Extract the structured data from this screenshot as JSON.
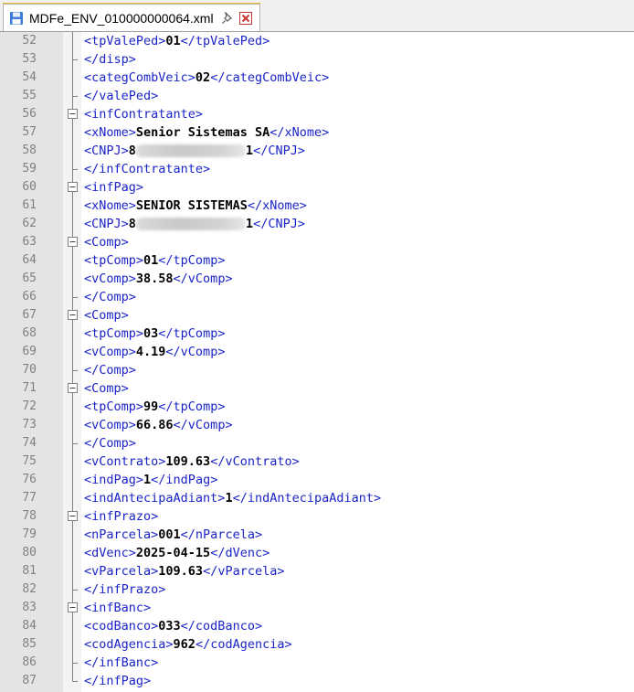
{
  "tab": {
    "title": "MDFe_ENV_010000000064.xml",
    "icons": [
      "save-icon",
      "pin-icon",
      "close-icon"
    ]
  },
  "lines": [
    {
      "n": "52",
      "parts": [
        [
          "t",
          "<tpValePed>"
        ],
        [
          "v",
          "01"
        ],
        [
          "t",
          "</tpValePed>"
        ]
      ]
    },
    {
      "n": "53",
      "parts": [
        [
          "t",
          "</disp>"
        ]
      ]
    },
    {
      "n": "54",
      "parts": [
        [
          "t",
          "<categCombVeic>"
        ],
        [
          "v",
          "02"
        ],
        [
          "t",
          "</categCombVeic>"
        ]
      ]
    },
    {
      "n": "55",
      "parts": [
        [
          "t",
          "</valePed>"
        ]
      ]
    },
    {
      "n": "56",
      "fold": "open",
      "parts": [
        [
          "t",
          "<infContratante>"
        ]
      ]
    },
    {
      "n": "57",
      "parts": [
        [
          "t",
          "<xNome>"
        ],
        [
          "v",
          "Senior Sistemas SA"
        ],
        [
          "t",
          "</xNome>"
        ]
      ]
    },
    {
      "n": "58",
      "parts": [
        [
          "t",
          "<CNPJ>"
        ],
        [
          "v",
          "8"
        ],
        [
          "b",
          ""
        ],
        [
          "v",
          "1"
        ],
        [
          "t",
          "</CNPJ>"
        ]
      ]
    },
    {
      "n": "59",
      "parts": [
        [
          "t",
          "</infContratante>"
        ]
      ]
    },
    {
      "n": "60",
      "fold": "open",
      "parts": [
        [
          "t",
          "<infPag>"
        ]
      ]
    },
    {
      "n": "61",
      "parts": [
        [
          "t",
          "<xNome>"
        ],
        [
          "v",
          "SENIOR SISTEMAS"
        ],
        [
          "t",
          "</xNome>"
        ]
      ]
    },
    {
      "n": "62",
      "parts": [
        [
          "t",
          "<CNPJ>"
        ],
        [
          "v",
          "8"
        ],
        [
          "b",
          ""
        ],
        [
          "v",
          "1"
        ],
        [
          "t",
          "</CNPJ>"
        ]
      ]
    },
    {
      "n": "63",
      "fold": "open",
      "parts": [
        [
          "t",
          "<Comp>"
        ]
      ]
    },
    {
      "n": "64",
      "parts": [
        [
          "t",
          "<tpComp>"
        ],
        [
          "v",
          "01"
        ],
        [
          "t",
          "</tpComp>"
        ]
      ]
    },
    {
      "n": "65",
      "parts": [
        [
          "t",
          "<vComp>"
        ],
        [
          "v",
          "38.58"
        ],
        [
          "t",
          "</vComp>"
        ]
      ]
    },
    {
      "n": "66",
      "parts": [
        [
          "t",
          "</Comp>"
        ]
      ]
    },
    {
      "n": "67",
      "fold": "open",
      "parts": [
        [
          "t",
          "<Comp>"
        ]
      ]
    },
    {
      "n": "68",
      "parts": [
        [
          "t",
          "<tpComp>"
        ],
        [
          "v",
          "03"
        ],
        [
          "t",
          "</tpComp>"
        ]
      ]
    },
    {
      "n": "69",
      "parts": [
        [
          "t",
          "<vComp>"
        ],
        [
          "v",
          "4.19"
        ],
        [
          "t",
          "</vComp>"
        ]
      ]
    },
    {
      "n": "70",
      "parts": [
        [
          "t",
          "</Comp>"
        ]
      ]
    },
    {
      "n": "71",
      "fold": "open",
      "parts": [
        [
          "t",
          "<Comp>"
        ]
      ]
    },
    {
      "n": "72",
      "parts": [
        [
          "t",
          "<tpComp>"
        ],
        [
          "v",
          "99"
        ],
        [
          "t",
          "</tpComp>"
        ]
      ]
    },
    {
      "n": "73",
      "parts": [
        [
          "t",
          "<vComp>"
        ],
        [
          "v",
          "66.86"
        ],
        [
          "t",
          "</vComp>"
        ]
      ]
    },
    {
      "n": "74",
      "parts": [
        [
          "t",
          "</Comp>"
        ]
      ]
    },
    {
      "n": "75",
      "parts": [
        [
          "t",
          "<vContrato>"
        ],
        [
          "v",
          "109.63"
        ],
        [
          "t",
          "</vContrato>"
        ]
      ]
    },
    {
      "n": "76",
      "parts": [
        [
          "t",
          "<indPag>"
        ],
        [
          "v",
          "1"
        ],
        [
          "t",
          "</indPag>"
        ]
      ]
    },
    {
      "n": "77",
      "parts": [
        [
          "t",
          "<indAntecipaAdiant>"
        ],
        [
          "v",
          "1"
        ],
        [
          "t",
          "</indAntecipaAdiant>"
        ]
      ]
    },
    {
      "n": "78",
      "fold": "open",
      "parts": [
        [
          "t",
          "<infPrazo>"
        ]
      ]
    },
    {
      "n": "79",
      "parts": [
        [
          "t",
          "<nParcela>"
        ],
        [
          "v",
          "001"
        ],
        [
          "t",
          "</nParcela>"
        ]
      ]
    },
    {
      "n": "80",
      "parts": [
        [
          "t",
          "<dVenc>"
        ],
        [
          "v",
          "2025-04-15"
        ],
        [
          "t",
          "</dVenc>"
        ]
      ]
    },
    {
      "n": "81",
      "parts": [
        [
          "t",
          "<vParcela>"
        ],
        [
          "v",
          "109.63"
        ],
        [
          "t",
          "</vParcela>"
        ]
      ]
    },
    {
      "n": "82",
      "parts": [
        [
          "t",
          "</infPrazo>"
        ]
      ]
    },
    {
      "n": "83",
      "fold": "open",
      "parts": [
        [
          "t",
          "<infBanc>"
        ]
      ]
    },
    {
      "n": "84",
      "parts": [
        [
          "t",
          "<codBanco>"
        ],
        [
          "v",
          "033"
        ],
        [
          "t",
          "</codBanco>"
        ]
      ]
    },
    {
      "n": "85",
      "parts": [
        [
          "t",
          "<codAgencia>"
        ],
        [
          "v",
          "962"
        ],
        [
          "t",
          "</codAgencia>"
        ]
      ]
    },
    {
      "n": "86",
      "parts": [
        [
          "t",
          "</infBanc>"
        ]
      ]
    },
    {
      "n": "87",
      "parts": [
        [
          "t",
          "</infPag>"
        ]
      ]
    }
  ],
  "colors": {
    "tag": "#1a24c8",
    "value": "#000000",
    "line_number": "#808080",
    "tab_accent": "#f6b833"
  }
}
